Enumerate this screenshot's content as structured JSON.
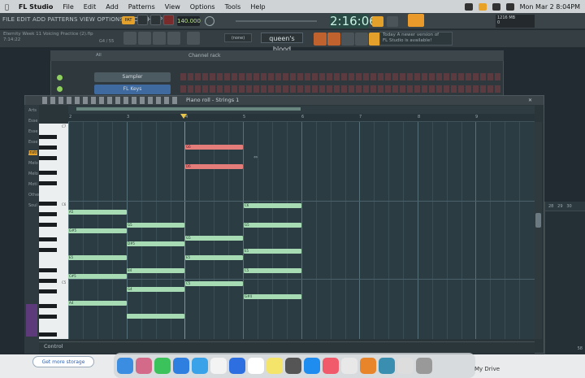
{
  "menubar": {
    "app": "FL Studio",
    "items": [
      "File",
      "Edit",
      "Add",
      "Patterns",
      "View",
      "Options",
      "Tools",
      "Help"
    ],
    "datetime": "Mon Mar 2  8:04PM"
  },
  "fl": {
    "menu": "FILE  EDIT  ADD  PATTERNS  VIEW  OPTIONS  TOOLS  HELP",
    "pat": "PAT",
    "tempo": "140.000",
    "time": "2:16:06",
    "cpu": "1216 MB",
    "cpu_line2": "0"
  },
  "project": {
    "line1": "Eternity Week 11 Voicing Practice (2).flp",
    "line2": "7:14:22",
    "pattern_ref": "G4 / 55"
  },
  "song": "queen's blood",
  "preset": "(none)",
  "news": {
    "line1": "Today  A newer version of",
    "line2": "FL Studio is available!"
  },
  "rack": {
    "filter": "All",
    "title": "Channel rack",
    "channels": [
      {
        "name": "Sampler"
      },
      {
        "name": "FL Keys"
      }
    ]
  },
  "piano_roll": {
    "title": "Piano roll - Strings 1",
    "ruler": [
      "2",
      "3",
      "4",
      "5",
      "6",
      "7",
      "8",
      "9"
    ],
    "control": "Control",
    "browser_items": [
      "Arts",
      "Esse",
      "Esse",
      "Esse",
      "Instr",
      "Melo",
      "Melo",
      "Moti",
      "Other",
      "Soul"
    ],
    "notes": [
      {
        "label": "G6",
        "color": "red"
      },
      {
        "label": "D6",
        "color": "red"
      },
      {
        "label": "A5",
        "color": "green"
      },
      {
        "label": "G#5",
        "color": "green"
      },
      {
        "label": "E5",
        "color": "green"
      },
      {
        "label": "C#5",
        "color": "green"
      },
      {
        "label": "A4",
        "color": "green"
      },
      {
        "label": "G5",
        "color": "green"
      },
      {
        "label": "D#5",
        "color": "green"
      },
      {
        "label": "B4",
        "color": "green"
      },
      {
        "label": "G4",
        "color": "green"
      },
      {
        "label": "G5",
        "color": "green"
      },
      {
        "label": "E5",
        "color": "green"
      },
      {
        "label": "C5",
        "color": "green"
      },
      {
        "label": "C6",
        "color": "green"
      },
      {
        "label": "G5",
        "color": "green"
      },
      {
        "label": "E5",
        "color": "green"
      },
      {
        "label": "C5",
        "color": "green"
      },
      {
        "label": "G#4",
        "color": "green"
      }
    ],
    "key_labels": {
      "c7": "C7",
      "c6": "C6",
      "c5": "C5"
    }
  },
  "right_panel": {
    "labels": [
      "28",
      "29",
      "30"
    ],
    "bottom": "58"
  },
  "dock": {
    "storage": "Get more storage",
    "drive": "My Drive"
  }
}
